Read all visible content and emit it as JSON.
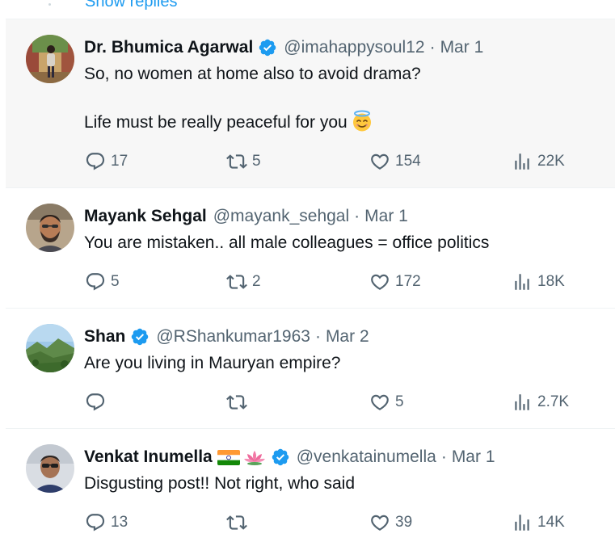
{
  "thread": {
    "show_replies_label": "Show replies",
    "replies": [
      {
        "name": "Dr. Bhumica Agarwal",
        "verified": true,
        "handle": "@imahappysoul12",
        "separator": "·",
        "date": "Mar 1",
        "text_line1": "So, no women at home also to avoid drama?",
        "text_line2": "Life must be really peaceful for you",
        "emoji": "smiling-face-with-halo",
        "stats": {
          "replies": "17",
          "retweets": "5",
          "likes": "154",
          "views": "22K"
        }
      },
      {
        "name": "Mayank Sehgal",
        "verified": false,
        "handle": "@mayank_sehgal",
        "separator": "·",
        "date": "Mar 1",
        "text_line1": "You are mistaken.. all male colleagues = office politics",
        "stats": {
          "replies": "5",
          "retweets": "2",
          "likes": "172",
          "views": "18K"
        }
      },
      {
        "name": "Shan",
        "verified": true,
        "handle": "@RShankumar1963",
        "separator": "·",
        "date": "Mar 2",
        "text_line1": "Are you living in Mauryan empire?",
        "stats": {
          "replies": "",
          "retweets": "",
          "likes": "5",
          "views": "2.7K"
        }
      },
      {
        "name": "Venkat Inumella",
        "verified": true,
        "name_emojis": [
          "india-flag",
          "lotus"
        ],
        "handle": "@venkatainumella",
        "separator": "·",
        "date": "Mar 1",
        "text_line1": "Disgusting post!! Not right, who said",
        "stats": {
          "replies": "13",
          "retweets": "",
          "likes": "39",
          "views": "14K"
        }
      }
    ]
  },
  "colors": {
    "verified_blue": "#1d9bf0",
    "secondary_text": "#536471",
    "primary_text": "#0f1419",
    "highlight_bg": "#f7f7f7",
    "divider": "#eff3f4"
  },
  "icons": {
    "reply": "reply-bubble-icon",
    "retweet": "retweet-icon",
    "like": "heart-icon",
    "views": "views-bar-chart-icon",
    "verified": "verified-badge-icon"
  }
}
